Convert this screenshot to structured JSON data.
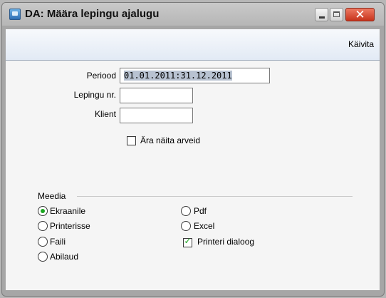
{
  "window": {
    "title": "DA: Määra lepingu ajalugu",
    "buttons": {
      "minimize": "minimize",
      "maximize": "maximize",
      "close": "close"
    }
  },
  "toolbar": {
    "run_label": "Käivita"
  },
  "form": {
    "periood": {
      "label": "Periood",
      "value": "01.01.2011:31.12.2011"
    },
    "lepingu_nr": {
      "label": "Lepingu nr.",
      "value": ""
    },
    "klient": {
      "label": "Klient",
      "value": ""
    },
    "ara_naita": {
      "label": "Ära näita arveid",
      "checked": false
    }
  },
  "media": {
    "label": "Meedia",
    "options": [
      {
        "label": "Ekraanile",
        "selected": true
      },
      {
        "label": "Printerisse",
        "selected": false
      },
      {
        "label": "Faili",
        "selected": false
      },
      {
        "label": "Abilaud",
        "selected": false
      },
      {
        "label": "Pdf",
        "selected": false
      },
      {
        "label": "Excel",
        "selected": false
      }
    ],
    "printer_dialog": {
      "label": "Printeri dialoog",
      "checked": true
    }
  },
  "colors": {
    "accent_check": "#1aa51f",
    "close_button": "#d2432a"
  }
}
